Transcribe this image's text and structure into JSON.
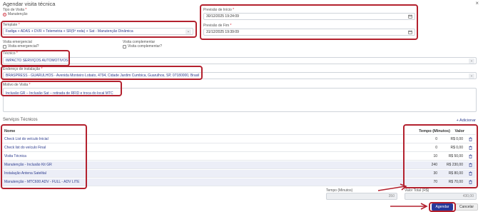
{
  "header": {
    "title": "Agendar visita técnica",
    "close": "×"
  },
  "tipo_visita": {
    "label": "Tipo de Visita",
    "required_mark": "*",
    "option": "Manutenção"
  },
  "previsao_inicio": {
    "label": "Previsão de Início",
    "required_mark": "*",
    "value": "30/12/2025 19:24:09"
  },
  "previsao_fim": {
    "label": "Previsão de Fim",
    "required_mark": "*",
    "value": "31/12/2025 19:39:09"
  },
  "template": {
    "label": "Template",
    "required_mark": "*",
    "value": "Fadiga + ADAS + DVR + Telemetria + SR(5ª roda) + Sat - Manutenção Dinâmica"
  },
  "visita_emergencial": {
    "label": "Visita emergencial",
    "checkbox_label": "Visita emergencial?"
  },
  "visita_complementar": {
    "label": "Visita complementar",
    "checkbox_label": "Visita complementar?"
  },
  "tecnico": {
    "label": "Técnico",
    "required_mark": "*",
    "value": "IMPACTO SERVIÇOS AUTOMOTIVOS"
  },
  "endereco": {
    "label": "Endereço de instalação",
    "required_mark": "*",
    "value": "BRASPRESS - GUARULHOS - Avenida Monteiro Lobato, 4794, Cidade Jardim Cumbica, Guarulhos, SP, 07180000, Brasil"
  },
  "motivo": {
    "label": "Motivo de Visita",
    "required_mark": "*",
    "value": "Inclusão GR – Inclusão Sat – retirada de RFID e troca do local MTC"
  },
  "servicos": {
    "title": "Serviços Técnicos",
    "add_label": "+ Adicionar",
    "columns": {
      "name": "Nome",
      "tempo": "Tempo (Minutos)",
      "valor": "Valor"
    },
    "rows": [
      {
        "name": "Check List do veículo Inicial",
        "tempo": "0",
        "valor": "R$ 0,00"
      },
      {
        "name": "Check list do veículo Final",
        "tempo": "0",
        "valor": "R$ 0,00"
      },
      {
        "name": "Visita Técnica",
        "tempo": "10",
        "valor": "R$ 50,00"
      },
      {
        "name": "Manutenção - Inclusão Kit GR",
        "tempo": "240",
        "valor": "R$ 230,00"
      },
      {
        "name": "Instalação Antena Satelital",
        "tempo": "30",
        "valor": "R$ 80,00"
      },
      {
        "name": "Manutenção - MTC600 ADV - FULL - ADV LITE",
        "tempo": "70",
        "valor": "R$ 70,00"
      }
    ]
  },
  "totals": {
    "tempo_label": "Tempo (Minutos)",
    "tempo_value": "350",
    "valor_label": "Valor Total (R$)",
    "valor_value": "430,00"
  },
  "actions": {
    "agendar": "Agendar",
    "cancelar": "Cancelar"
  },
  "colors": {
    "highlight": "#b3212e",
    "primary": "#27389a",
    "link": "#2e3d8f"
  }
}
